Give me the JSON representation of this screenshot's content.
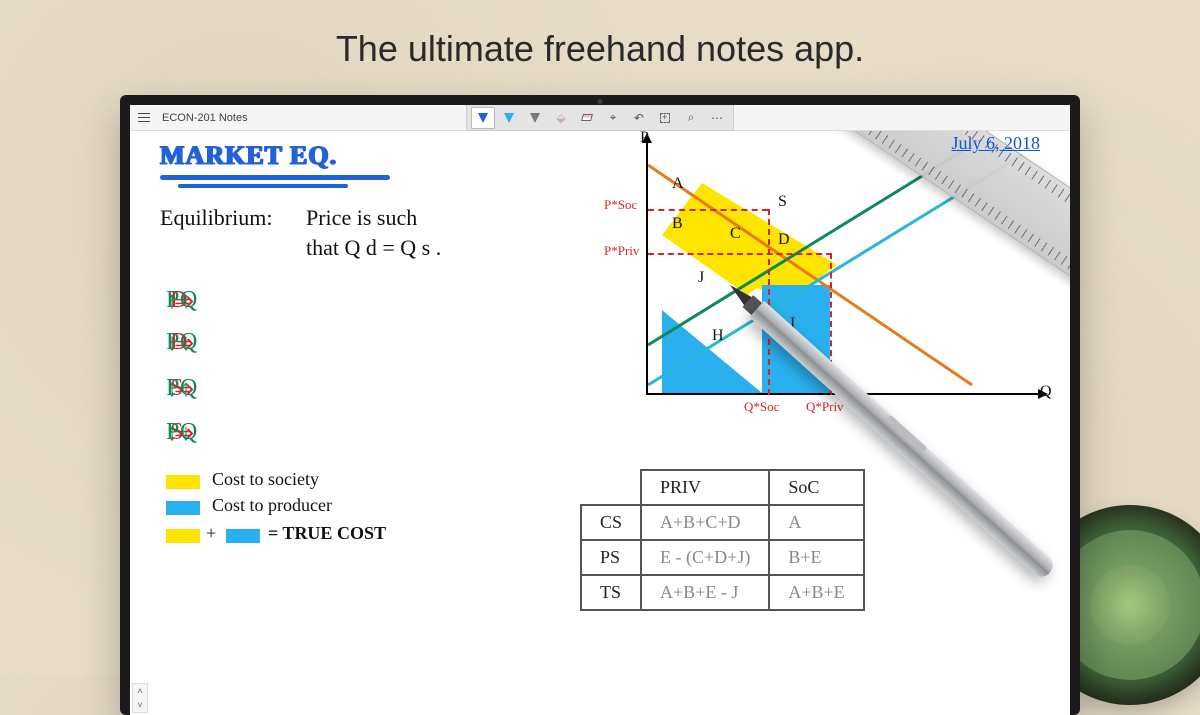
{
  "promo": {
    "tagline": "The ultimate freehand notes app."
  },
  "titlebar": {
    "doc_title": "ECON-201 Notes"
  },
  "toolbar": {
    "tools": [
      {
        "name": "pen-blue",
        "color": "#2262d8"
      },
      {
        "name": "pen-cyan",
        "color": "#2ab0ef"
      },
      {
        "name": "pen-gray",
        "color": "#7a7a7a"
      },
      {
        "name": "highlighter",
        "glyph": "⬙"
      },
      {
        "name": "eraser"
      },
      {
        "name": "lasso",
        "glyph": "⌖"
      },
      {
        "name": "undo",
        "glyph": "↶"
      },
      {
        "name": "insert-image"
      },
      {
        "name": "zoom",
        "glyph": "⌕"
      },
      {
        "name": "more",
        "glyph": "⋯"
      }
    ]
  },
  "note": {
    "title": "MARKET EQ.",
    "date": "July 6, 2018",
    "equilibrium_line1": "Equilibrium:",
    "equilibrium_line1b": "Price is such",
    "equilibrium_line2": "that  Q d = Q s .",
    "relations": [
      {
        "lhs_arrow": "↑",
        "lhs": "D",
        "p_arrow": "↑",
        "q_arrow": "↑"
      },
      {
        "lhs_arrow": "↓",
        "lhs": "D",
        "p_arrow": "↓",
        "q_arrow": "↓"
      },
      {
        "lhs_arrow": "↑",
        "lhs": "S",
        "p_arrow": "↓",
        "q_arrow": "↑"
      },
      {
        "lhs_arrow": "↓",
        "lhs": "S",
        "p_arrow": "↑",
        "q_arrow": "↓"
      }
    ],
    "legend": {
      "yellow": "Cost to society",
      "blue": "Cost to producer",
      "sum": " = TRUE COST"
    },
    "graph": {
      "y_label": "P",
      "x_label": "Q",
      "p_soc": "P*Soc",
      "p_priv": "P*Priv",
      "q_soc": "Q*Soc",
      "q_priv": "Q*Priv",
      "regions": [
        "A",
        "B",
        "C",
        "D",
        "S",
        "J",
        "H",
        "I"
      ]
    },
    "table": {
      "col1": "PRIV",
      "col2": "SoC",
      "rows": [
        {
          "h": "CS",
          "c1": "A+B+C+D",
          "c2": "A"
        },
        {
          "h": "PS",
          "c1": "E - (C+D+J)",
          "c2": "B+E"
        },
        {
          "h": "TS",
          "c1": "A+B+E - J",
          "c2": "A+B+E"
        }
      ]
    }
  }
}
